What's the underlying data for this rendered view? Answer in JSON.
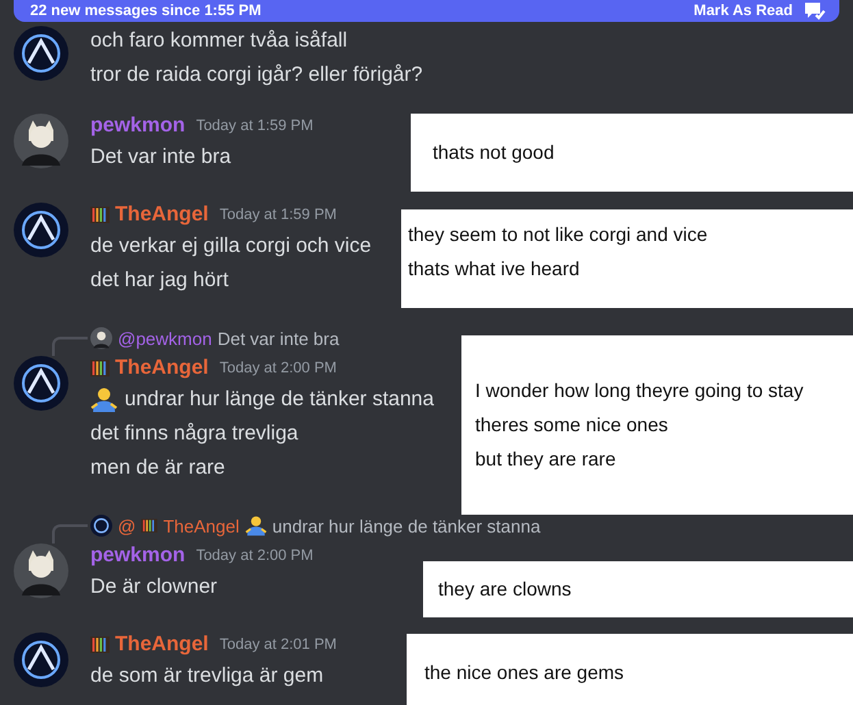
{
  "banner": {
    "text": "22 new messages since 1:55 PM",
    "action": "Mark As Read"
  },
  "messages": [
    {
      "avatar": {
        "kind": "picture"
      },
      "lines": [
        "och faro kommer tvåa isåfall",
        "tror de raida corgi igår? eller förigår?"
      ]
    },
    {
      "avatar": {
        "kind": "picture"
      },
      "author": "pewkmon",
      "color": "#a463e8",
      "badge": false,
      "time": "Today at 1:59 PM",
      "lines": [
        "Det var inte bra"
      ]
    },
    {
      "avatar": {
        "kind": "picture"
      },
      "author": "TheAngel",
      "color": "#e8663a",
      "badge": true,
      "time": "Today at 1:59 PM",
      "lines": [
        "de verkar ej gilla corgi och vice",
        "det har jag hört"
      ]
    },
    {
      "avatar": {
        "kind": "picture"
      },
      "reply": {
        "avatar": {
          "kind": "picture"
        },
        "at": "@pewkmon",
        "color": "#a463e8",
        "badge": false,
        "emoji": false,
        "text": "Det var inte bra"
      },
      "author": "TheAngel",
      "color": "#e8663a",
      "badge": true,
      "time": "Today at 2:00 PM",
      "emoji_first": true,
      "lines": [
        "undrar hur länge de tänker stanna",
        "det finns några trevliga",
        "men de är rare"
      ]
    },
    {
      "avatar": {
        "kind": "picture"
      },
      "reply": {
        "avatar": {
          "kind": "picture"
        },
        "at": "@",
        "name": "TheAngel",
        "color": "#e8663a",
        "badge": true,
        "emoji": true,
        "text": "undrar hur länge de tänker stanna"
      },
      "author": "pewkmon",
      "color": "#a463e8",
      "badge": false,
      "time": "Today at 2:00 PM",
      "lines": [
        "De är clowner"
      ]
    },
    {
      "avatar": {
        "kind": "picture"
      },
      "author": "TheAngel",
      "color": "#e8663a",
      "badge": true,
      "time": "Today at 2:01 PM",
      "lines": [
        "de som är trevliga är gem"
      ]
    }
  ],
  "notes": [
    {
      "lines": [
        "thats not good"
      ]
    },
    {
      "lines": [
        "they seem to not like corgi and vice",
        "thats what ive heard"
      ]
    },
    {
      "lines": [
        "I wonder how long theyre going to stay",
        "theres some nice ones",
        "but they are rare"
      ]
    },
    {
      "lines": [
        "they are clowns"
      ]
    },
    {
      "lines": [
        "the nice ones are gems"
      ]
    }
  ]
}
